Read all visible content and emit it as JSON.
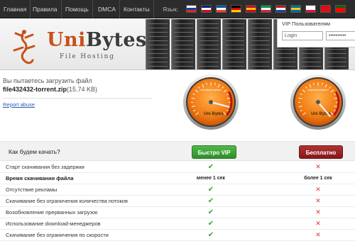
{
  "nav": {
    "items": [
      "Главная",
      "Правила",
      "Помощь",
      "DMCA",
      "Контакты"
    ],
    "language_label": "Язык:",
    "flags": [
      {
        "name": "russian-flag-icon",
        "colors": [
          "#ffffff",
          "#1c3f9c",
          "#d52b1e"
        ]
      },
      {
        "name": "uk-flag-icon",
        "colors": [
          "#012169",
          "#ffffff",
          "#c8102e"
        ]
      },
      {
        "name": "french-flag-icon",
        "colors": [
          "#0055a4",
          "#ffffff",
          "#ef4135"
        ]
      },
      {
        "name": "german-flag-icon",
        "colors": [
          "#000000",
          "#dd0000",
          "#ffce00"
        ]
      },
      {
        "name": "spanish-flag-icon",
        "colors": [
          "#c60b1e",
          "#ffc400",
          "#c60b1e"
        ]
      },
      {
        "name": "italian-flag-icon",
        "colors": [
          "#009246",
          "#ffffff",
          "#ce2b37"
        ]
      },
      {
        "name": "dutch-flag-icon",
        "colors": [
          "#ae1c28",
          "#ffffff",
          "#21468b"
        ]
      },
      {
        "name": "swedish-flag-icon",
        "colors": [
          "#006aa7",
          "#fecc00",
          "#006aa7"
        ]
      },
      {
        "name": "polish-flag-icon",
        "colors": [
          "#ffffff",
          "#ffffff",
          "#dc143c"
        ]
      },
      {
        "name": "turkish-flag-icon",
        "colors": [
          "#e30a17",
          "#e30a17",
          "#e30a17"
        ]
      },
      {
        "name": "portuguese-flag-icon",
        "colors": [
          "#006600",
          "#ff0000",
          "#ff0000"
        ]
      }
    ]
  },
  "logo": {
    "name_first": "Uni",
    "name_second": "Bytes",
    "subtitle": "File Hosting",
    "accent": "#c8501a"
  },
  "vip_login": {
    "title": "VIP Пользователям",
    "login_value": "Login",
    "password_value": "••••••••••"
  },
  "file": {
    "trying_text": "Вы пытаетесь загрузить файл",
    "name": "file432432-torrent.zip",
    "size": "(15.74 KB)",
    "report_link": "Report abuse"
  },
  "gauge": {
    "brand": "Uni Bytes",
    "caption": "download speed"
  },
  "compare": {
    "question": "Как будем качать?",
    "vip_button": "Быстро VIP",
    "free_button": "Бесплатно",
    "vip_color": "#3aa43a",
    "free_color": "#9e2424",
    "rows": [
      {
        "label": "Старт скачивания без задержки",
        "bold": false,
        "vip": "check",
        "free": "cross"
      },
      {
        "label": "Время скачивания файла",
        "bold": true,
        "vip": "менее 1 сек",
        "free": "более 1 сек"
      },
      {
        "label": "Отсутствие рекламы",
        "bold": false,
        "vip": "check",
        "free": "cross"
      },
      {
        "label": "Скачивание без ограничения количества потоков",
        "bold": false,
        "vip": "check",
        "free": "cross"
      },
      {
        "label": "Возобновление прерванных загрузок",
        "bold": false,
        "vip": "check",
        "free": "cross"
      },
      {
        "label": "Использование download-менеджеров",
        "bold": false,
        "vip": "check",
        "free": "cross"
      },
      {
        "label": "Скачивание без ограничения по скорости",
        "bold": false,
        "vip": "check",
        "free": "cross"
      }
    ]
  }
}
